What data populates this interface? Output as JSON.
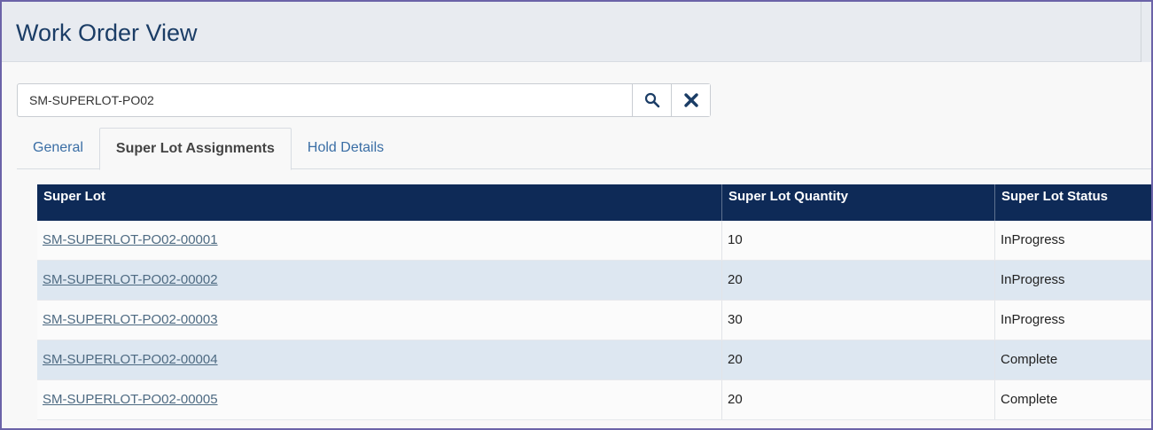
{
  "header": {
    "title": "Work Order View"
  },
  "search": {
    "value": "SM-SUPERLOT-PO02"
  },
  "tabs": [
    {
      "label": "General",
      "active": false
    },
    {
      "label": "Super Lot Assignments",
      "active": true
    },
    {
      "label": "Hold Details",
      "active": false
    }
  ],
  "table": {
    "columns": [
      "Super Lot",
      "Super Lot Quantity",
      "Super Lot Status"
    ],
    "rows": [
      {
        "lot": "SM-SUPERLOT-PO02-00001",
        "qty": "10",
        "status": "InProgress"
      },
      {
        "lot": "SM-SUPERLOT-PO02-00002",
        "qty": "20",
        "status": "InProgress"
      },
      {
        "lot": "SM-SUPERLOT-PO02-00003",
        "qty": "30",
        "status": "InProgress"
      },
      {
        "lot": "SM-SUPERLOT-PO02-00004",
        "qty": "20",
        "status": "Complete"
      },
      {
        "lot": "SM-SUPERLOT-PO02-00005",
        "qty": "20",
        "status": "Complete"
      }
    ]
  },
  "colors": {
    "header_bg": "#0e2a57",
    "title": "#1b3d66",
    "tab_link": "#3a6ea5",
    "alt_row": "#dde7f1"
  },
  "icons": {
    "search": "search-icon",
    "clear": "close-icon"
  }
}
